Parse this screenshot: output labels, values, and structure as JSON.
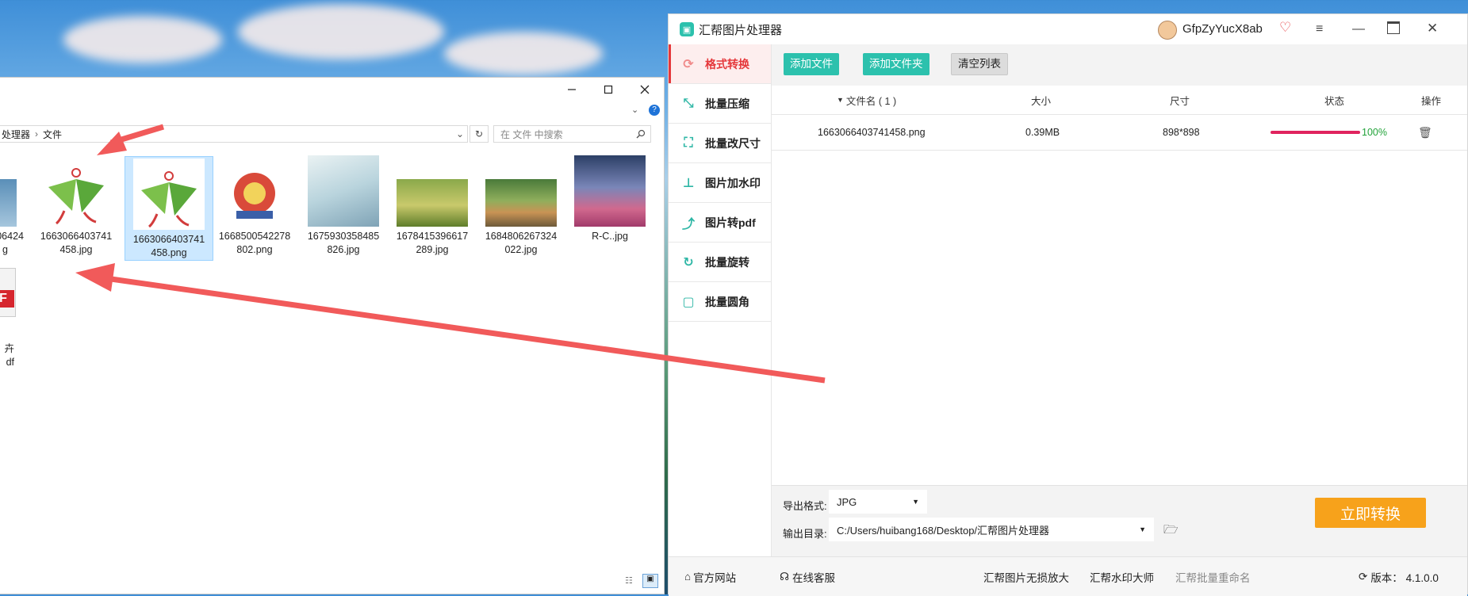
{
  "explorer": {
    "breadcrumb": [
      "处理器",
      "文件"
    ],
    "search_placeholder": "在 文件 中搜索",
    "files": [
      {
        "name_line1": "06424",
        "name_line2": "g",
        "partial": true
      },
      {
        "name_line1": "1663066403741",
        "name_line2": "458.jpg"
      },
      {
        "name_line1": "1663066403741",
        "name_line2": "458.png",
        "selected": true
      },
      {
        "name_line1": "1668500542278",
        "name_line2": "802.png"
      },
      {
        "name_line1": "1675930358485",
        "name_line2": "826.jpg"
      },
      {
        "name_line1": "1678415396617",
        "name_line2": "289.jpg"
      },
      {
        "name_line1": "1684806267324",
        "name_line2": "022.jpg"
      },
      {
        "name_line1": "R-C..jpg",
        "name_line2": ""
      }
    ],
    "partial_file": {
      "name_line1": "卉",
      "name_line2": "df",
      "badge": "F"
    }
  },
  "app": {
    "title": "汇帮图片处理器",
    "username": "GfpZyYucX8ab",
    "sidebar": [
      {
        "label": "格式转换",
        "icon": "convert-icon",
        "active": true
      },
      {
        "label": "批量压缩",
        "icon": "compress-icon"
      },
      {
        "label": "批量改尺寸",
        "icon": "resize-icon"
      },
      {
        "label": "图片加水印",
        "icon": "watermark-icon"
      },
      {
        "label": "图片转pdf",
        "icon": "pdf-icon"
      },
      {
        "label": "批量旋转",
        "icon": "rotate-icon"
      },
      {
        "label": "批量圆角",
        "icon": "round-corner-icon"
      }
    ],
    "toolbar": {
      "add_file": "添加文件",
      "add_folder": "添加文件夹",
      "clear_list": "清空列表"
    },
    "table": {
      "headers": {
        "name": "文件名 ( 1 )",
        "size": "大小",
        "dimensions": "尺寸",
        "status": "状态",
        "action": "操作"
      },
      "rows": [
        {
          "name": "1663066403741458.png",
          "size": "0.39MB",
          "dimensions": "898*898",
          "progress": 1.0,
          "progress_text": "100%"
        }
      ]
    },
    "export": {
      "format_label": "导出格式:",
      "format_value": "JPG",
      "dir_label": "输出目录:",
      "dir_value": "C:/Users/huibang168/Desktop/汇帮图片处理器",
      "convert_button": "立即转换"
    },
    "footer": {
      "website": "官方网站",
      "support": "在线客服",
      "link1": "汇帮图片无损放大",
      "link2": "汇帮水印大师",
      "link3": "汇帮批量重命名",
      "version": "版本： 4.1.0.0"
    }
  },
  "colors": {
    "accent_red": "#e5383b",
    "teal": "#2cc1ad",
    "orange": "#f7a21b",
    "progress": "#e0245e",
    "progress_text": "#22a33a"
  }
}
